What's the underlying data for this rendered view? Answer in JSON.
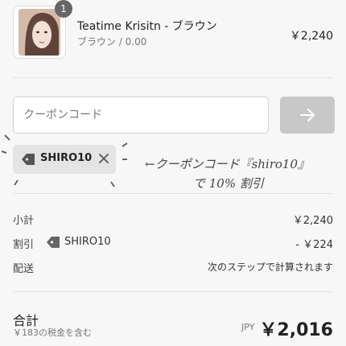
{
  "product": {
    "quantity": "1",
    "name": "Teatime Krisitn - ブラウン",
    "variant": "ブラウン / 0.00",
    "price": "￥2,240"
  },
  "coupon": {
    "placeholder": "クーポンコード",
    "applied_code": "SHIRO10"
  },
  "annotation": {
    "line1": "←クーポンコード『shiro10』",
    "line2": "で 10% 割引"
  },
  "summary": {
    "subtotal_label": "小計",
    "subtotal_value": "￥2,240",
    "discount_label": "割引",
    "discount_code": "SHIRO10",
    "discount_value": "- ￥224",
    "shipping_label": "配送",
    "shipping_value": "次のステップで計算されます",
    "total_label": "合計",
    "tax_note": "￥183の税金を含む",
    "currency": "JPY",
    "total_value": "￥2,016"
  },
  "colors": {
    "apply_button": "#c8c8c8",
    "coupon_tag_bg": "#e4e4e4"
  }
}
